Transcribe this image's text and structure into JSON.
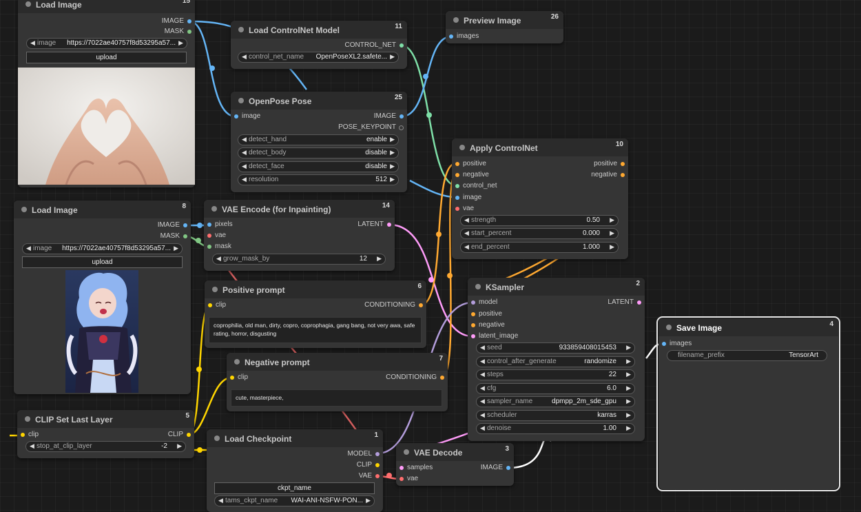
{
  "colors": {
    "image": "#64b5f6",
    "mask": "#81c784",
    "control_net": "#00d78d",
    "latent": "#ff9cf9",
    "conditioning": "#ffa931",
    "clip": "#ffd500",
    "model": "#b39ddb",
    "vae": "#ff6e6e"
  },
  "nodes": {
    "load_image_15": {
      "title": "Load Image",
      "id": "15",
      "outputs": [
        "IMAGE",
        "MASK"
      ],
      "widget_name": "image",
      "widget_value": "https://7022ae40757f8d53295a57...",
      "upload_label": "upload"
    },
    "load_controlnet_11": {
      "title": "Load ControlNet Model",
      "id": "11",
      "output": "CONTROL_NET",
      "widget_name": "control_net_name",
      "widget_value": "OpenPoseXL2.safete..."
    },
    "preview_image_26": {
      "title": "Preview Image",
      "id": "26",
      "input": "images"
    },
    "openpose_25": {
      "title": "OpenPose Pose",
      "id": "25",
      "input": "image",
      "outputs": [
        "IMAGE",
        "POSE_KEYPOINT"
      ],
      "widgets": [
        {
          "name": "detect_hand",
          "value": "enable"
        },
        {
          "name": "detect_body",
          "value": "disable"
        },
        {
          "name": "detect_face",
          "value": "disable"
        },
        {
          "name": "resolution",
          "value": "512"
        }
      ]
    },
    "apply_controlnet_10": {
      "title": "Apply ControlNet",
      "id": "10",
      "inputs": [
        "positive",
        "negative",
        "control_net",
        "image",
        "vae"
      ],
      "outputs": [
        "positive",
        "negative"
      ],
      "widgets": [
        {
          "name": "strength",
          "value": "0.50"
        },
        {
          "name": "start_percent",
          "value": "0.000"
        },
        {
          "name": "end_percent",
          "value": "1.000"
        }
      ]
    },
    "load_image_8": {
      "title": "Load Image",
      "id": "8",
      "outputs": [
        "IMAGE",
        "MASK"
      ],
      "widget_name": "image",
      "widget_value": "https://7022ae40757f8d53295a57...",
      "upload_label": "upload"
    },
    "vae_encode_14": {
      "title": "VAE Encode (for Inpainting)",
      "id": "14",
      "inputs": [
        "pixels",
        "vae",
        "mask"
      ],
      "output": "LATENT",
      "widget_name": "grow_mask_by",
      "widget_value": "12"
    },
    "positive_prompt_6": {
      "title": "Positive prompt",
      "id": "6",
      "input": "clip",
      "output": "CONDITIONING",
      "text": "coprophilia, old man, dirty, copro, coprophagia, gang bang, not very awa, safe rating, horror, disgusting"
    },
    "negative_prompt_7": {
      "title": "Negative prompt",
      "id": "7",
      "input": "clip",
      "output": "CONDITIONING",
      "text": "cute, masterpiece,"
    },
    "ksampler_2": {
      "title": "KSampler",
      "id": "2",
      "inputs": [
        "model",
        "positive",
        "negative",
        "latent_image"
      ],
      "output": "LATENT",
      "widgets": [
        {
          "name": "seed",
          "value": "933859408015453"
        },
        {
          "name": "control_after_generate",
          "value": "randomize"
        },
        {
          "name": "steps",
          "value": "22"
        },
        {
          "name": "cfg",
          "value": "6.0"
        },
        {
          "name": "sampler_name",
          "value": "dpmpp_2m_sde_gpu"
        },
        {
          "name": "scheduler",
          "value": "karras"
        },
        {
          "name": "denoise",
          "value": "1.00"
        }
      ]
    },
    "save_image_4": {
      "title": "Save Image",
      "id": "4",
      "input": "images",
      "widget_name": "filename_prefix",
      "widget_value": "TensorArt"
    },
    "clip_set_last_layer_5": {
      "title": "CLIP Set Last Layer",
      "id": "5",
      "input": "clip",
      "output": "CLIP",
      "widget_name": "stop_at_clip_layer",
      "widget_value": "-2"
    },
    "load_checkpoint_1": {
      "title": "Load Checkpoint",
      "id": "1",
      "outputs": [
        "MODEL",
        "CLIP",
        "VAE"
      ],
      "button_label": "ckpt_name",
      "widget_name": "tams_ckpt_name",
      "widget_value": "WAI-ANI-NSFW-PON..."
    },
    "vae_decode_3": {
      "title": "VAE Decode",
      "id": "3",
      "inputs": [
        "samples",
        "vae"
      ],
      "output": "IMAGE"
    }
  }
}
